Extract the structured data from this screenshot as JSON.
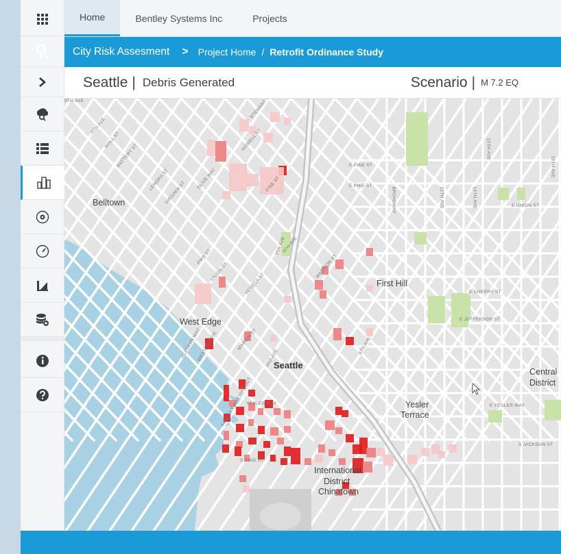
{
  "tabs": [
    "Home",
    "Bentley Systems Inc",
    "Projects"
  ],
  "breadcrumb": {
    "root": "City Risk Assesment",
    "project": "Project Home",
    "separator": "/",
    "current": "Retrofit Ordinance Study"
  },
  "header": {
    "city": "Seattle",
    "metric": "Debris Generated",
    "scenario_label": "Scenario",
    "scenario_value": "M 7.2 EQ"
  },
  "rail_icons": [
    "grid-icon",
    "location-search-icon",
    "chevron-right-icon",
    "hazard-cloud-icon",
    "list-icon",
    "buildings-icon",
    "settings-circle-icon",
    "gauge-icon",
    "retrofit-chart-icon",
    "database-add-icon",
    "info-icon",
    "help-icon"
  ],
  "map": {
    "places": [
      "Belltown",
      "First Hill",
      "West Edge",
      "Seattle",
      "Yesler",
      "Terrace",
      "Central",
      "District",
      "International",
      "District",
      "Chinatown"
    ],
    "streets": [
      "E PINE ST",
      "E PIKE ST",
      "E UNION ST",
      "E CHERRY ST",
      "E JEFFERSON ST",
      "E YESLER WAY",
      "S JACKSON ST",
      "S KING ST",
      "BROADWAY",
      "12TH AVE",
      "14TH AVE",
      "15TH AVE",
      "19TH AVE",
      "5TH AVE",
      "WALL ST",
      "BATTERY ST",
      "LENORA ST",
      "VIRGINIA ST",
      "OLIVE WAY",
      "STEWART ST",
      "HOWELL ST",
      "PINE ST",
      "PIKE ST",
      "UNION ST",
      "SENECA ST",
      "MADISON ST",
      "MARION ST",
      "YESLER WAY",
      "ALASKAN WAY",
      "WESTERN AVE",
      "ALASKAN WAY VIADUCT",
      "3RD AVE",
      "4TH AVE",
      "7TH AVE",
      "8TH AVE",
      "9TH AVE"
    ]
  },
  "colors": {
    "accent": "#1a9bd7",
    "water": "#a8d1e4",
    "park": "#c9e2a8",
    "debris_high": "#e01b1b",
    "debris_mid": "#ee7d7d",
    "debris_low": "#f6c6c6"
  }
}
